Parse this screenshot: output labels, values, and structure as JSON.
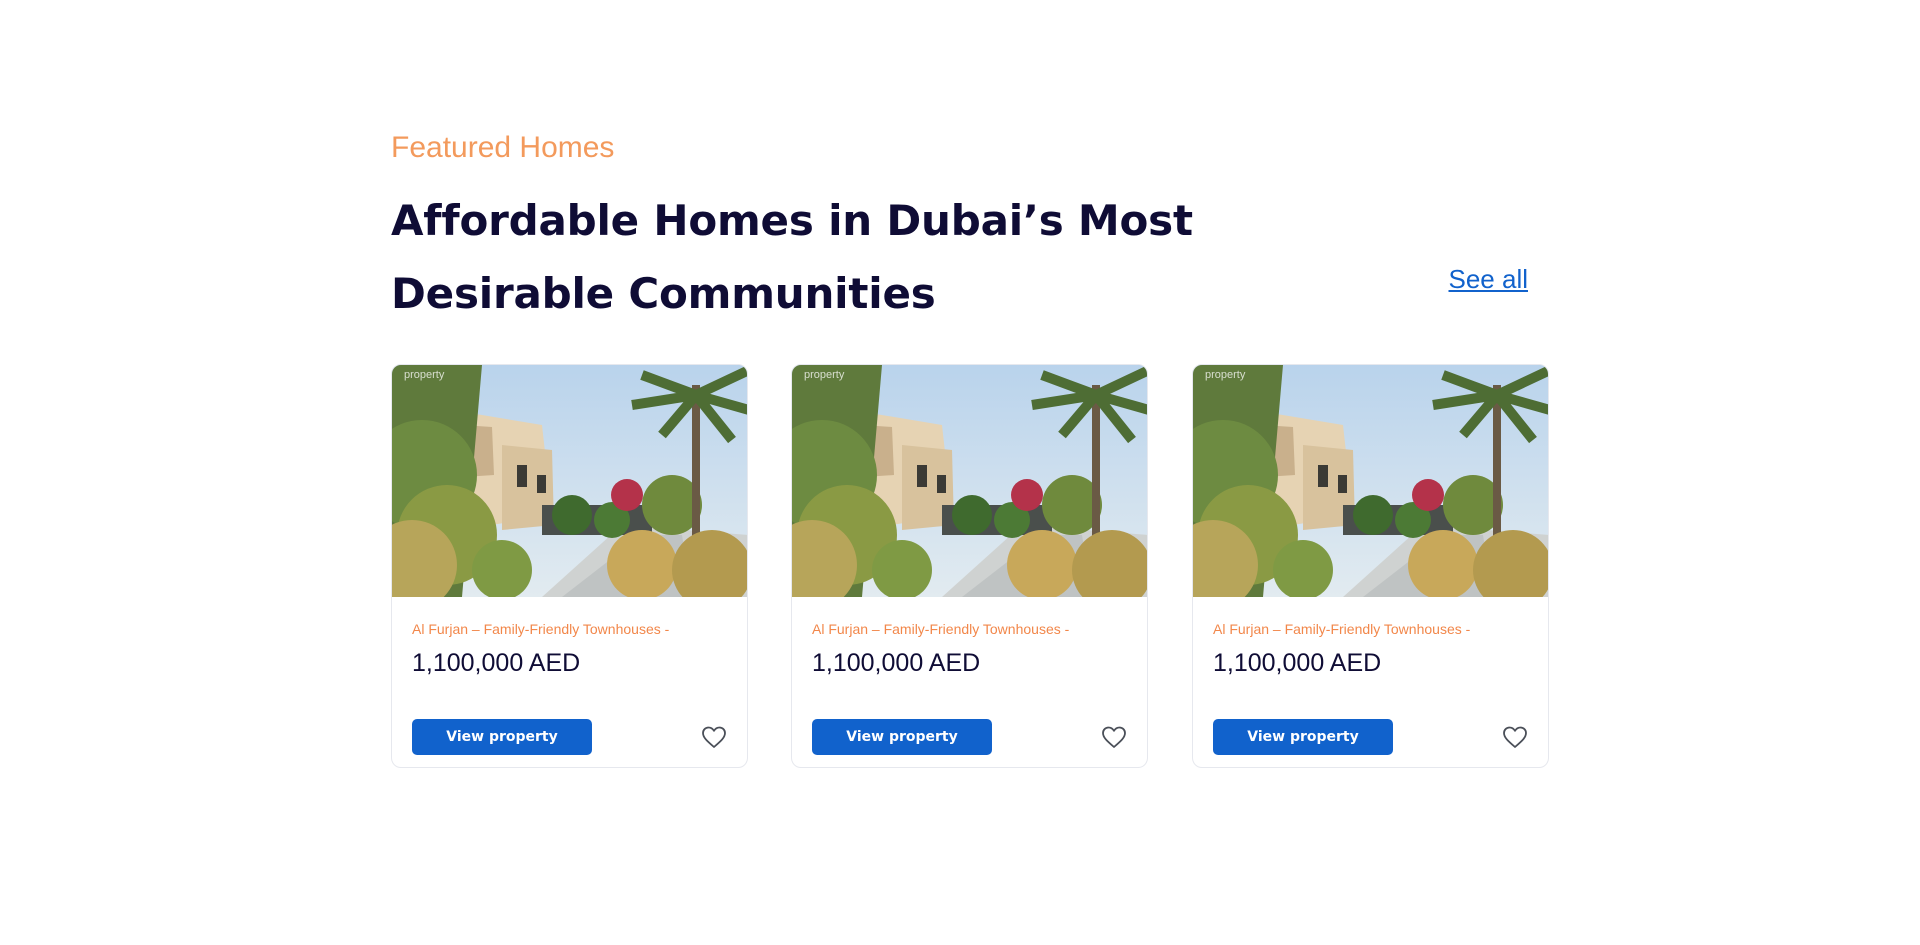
{
  "section": {
    "eyebrow": "Featured Homes",
    "heading": "Affordable Homes in Dubai’s Most Desirable Communities",
    "see_all": "See all"
  },
  "cards": [
    {
      "watermark": "property",
      "title": "Al Furjan – Family-Friendly Townhouses -",
      "price": "1,100,000 AED",
      "button": "View property",
      "icon": "heart-icon"
    },
    {
      "watermark": "property",
      "title": "Al Furjan – Family-Friendly Townhouses -",
      "price": "1,100,000 AED",
      "button": "View property",
      "icon": "heart-icon"
    },
    {
      "watermark": "property",
      "title": "Al Furjan – Family-Friendly Townhouses -",
      "price": "1,100,000 AED",
      "button": "View property",
      "icon": "heart-icon"
    }
  ],
  "colors": {
    "accent_orange": "#f39a5c",
    "heading_navy": "#0f0c35",
    "primary_blue": "#1162cc"
  }
}
